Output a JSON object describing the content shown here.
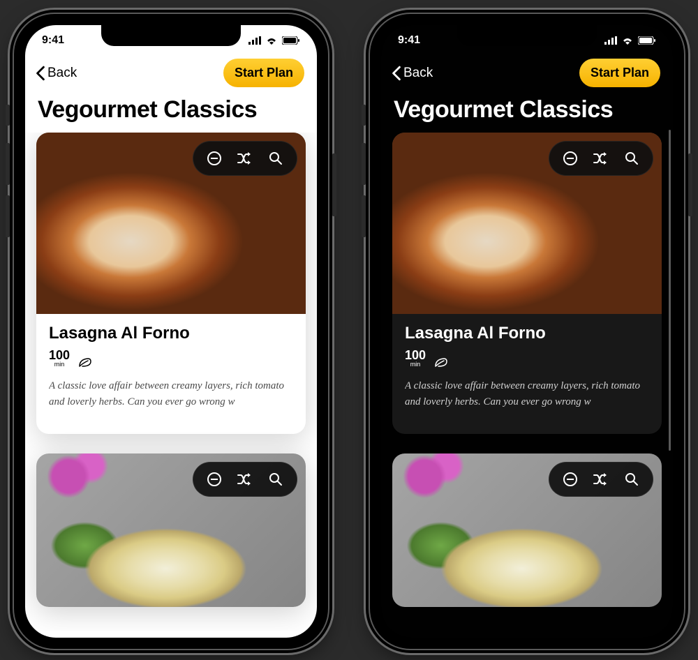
{
  "status": {
    "time": "9:41"
  },
  "nav": {
    "back": "Back",
    "cta": "Start Plan"
  },
  "page": {
    "title": "Vegourmet Classics"
  },
  "cards": [
    {
      "title": "Lasagna Al Forno",
      "time_value": "100",
      "time_unit": "min",
      "description": "A classic love affair between creamy layers, rich tomato and loverly herbs. Can you ever go wrong w"
    }
  ]
}
